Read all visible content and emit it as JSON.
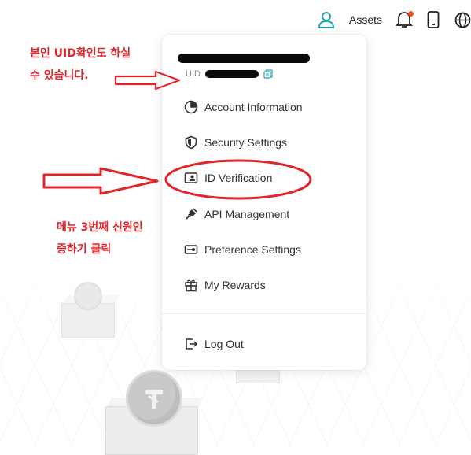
{
  "nav": {
    "assets_label": "Assets",
    "icons": [
      "user-icon",
      "bell-icon",
      "phone-icon",
      "globe-icon"
    ],
    "badge_color": "#ff4d1a",
    "accent_color": "#1fa7b3"
  },
  "account": {
    "uid_label": "UID"
  },
  "menu": [
    {
      "label": "Account Information",
      "icon": "pie-chart-icon"
    },
    {
      "label": "Security Settings",
      "icon": "shield-icon"
    },
    {
      "label": "ID Verification",
      "icon": "id-card-icon"
    },
    {
      "label": "API Management",
      "icon": "plug-icon"
    },
    {
      "label": "Preference Settings",
      "icon": "toggle-icon"
    },
    {
      "label": "My Rewards",
      "icon": "gift-icon"
    }
  ],
  "logout_label": "Log Out",
  "annotations": {
    "uid_note_line1": "본인 UID확인도 하실",
    "uid_note_line2": "수 있습니다.",
    "menu_note_line1": "메뉴 3번째 신원인",
    "menu_note_line2": "증하기 클릭",
    "color": "#e3242b"
  }
}
